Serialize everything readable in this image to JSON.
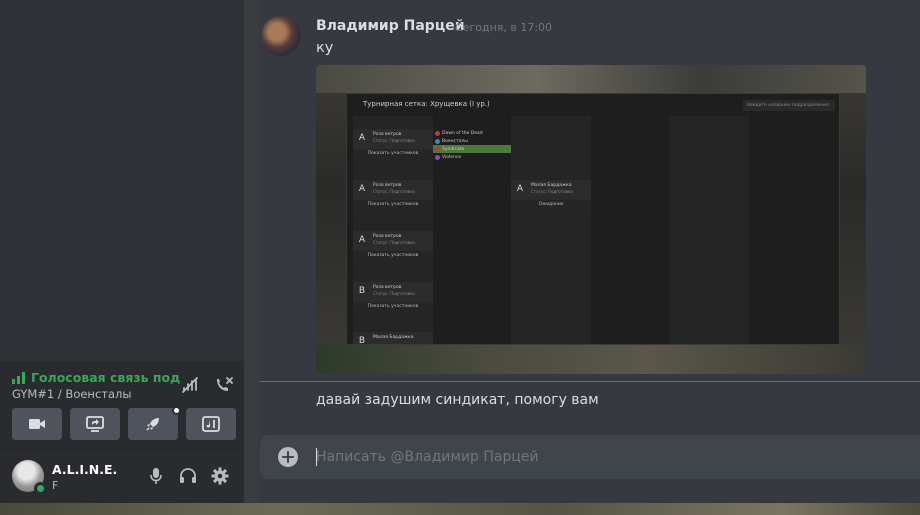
{
  "voice": {
    "status": "Голосовая связь под",
    "channel": "GYM#1 / Военсталы",
    "status_color": "#3ba55d"
  },
  "user": {
    "name": "A.L.I.N.E.",
    "tag": "F"
  },
  "message": {
    "author": "Владимир Парцей",
    "time": "Сегодня, в 17:00",
    "text": "ку",
    "followup": "давай задушим синдикат, помогу вам"
  },
  "attachment": {
    "window_title": "Турнирная сетка: Хрущевка (I ур.)",
    "search_placeholder": "Введите название подразделения",
    "teams": [
      {
        "letter": "A",
        "name": "Роза ветров",
        "status": "Статус: Подготовка",
        "button": "Показать участников"
      },
      {
        "letter": "A",
        "name": "Роза ветров",
        "status": "Статус: Подготовка",
        "button": "Показать участников"
      },
      {
        "letter": "A",
        "name": "Роза ветров",
        "status": "Статус: Подготовка",
        "button": "Показать участников"
      },
      {
        "letter": "B",
        "name": "Роза ветров",
        "status": "Статус: Подготовка",
        "button": "Показать участников"
      },
      {
        "letter": "B",
        "name": "Малая Бардажка",
        "status": "",
        "button": ""
      }
    ],
    "round2": {
      "letter": "A",
      "name": "Малая Бардажка",
      "status": "Статус: Подготовка",
      "button": "Ожидание"
    },
    "opponents": [
      "Dawn of the Dead",
      "Военсталы",
      "Syndicate",
      "Violence"
    ]
  },
  "composer": {
    "placeholder": "Написать @Владимир Парцей"
  }
}
